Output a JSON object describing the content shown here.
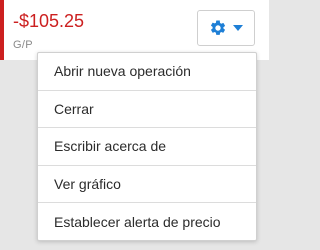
{
  "header": {
    "pl_value": "-$105.25",
    "pl_label": "G/P",
    "accent_color": "#cc2020"
  },
  "settings_button": {
    "icon": "gear-icon",
    "dropdown_icon": "caret-down-icon",
    "icon_color": "#1e7fd6"
  },
  "menu": {
    "items": [
      {
        "label": "Abrir nueva operación"
      },
      {
        "label": "Cerrar"
      },
      {
        "label": "Escribir acerca de"
      },
      {
        "label": "Ver gráfico"
      },
      {
        "label": "Establecer alerta de precio"
      }
    ]
  }
}
